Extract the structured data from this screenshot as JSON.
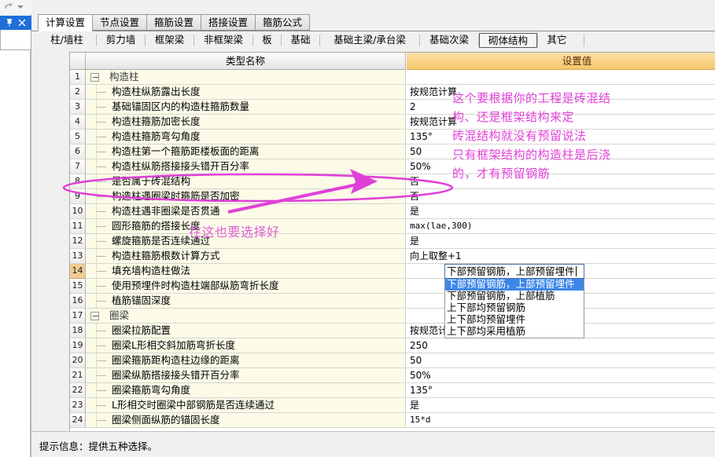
{
  "left_rail": {
    "redo_icon": "redo-icon",
    "redo_caret": "chevron-down-icon",
    "pin_icon": "pin-icon",
    "close_icon": "close-icon"
  },
  "tabs_primary": [
    {
      "label": "计算设置",
      "selected": true
    },
    {
      "label": "节点设置",
      "selected": false
    },
    {
      "label": "箍筋设置",
      "selected": false
    },
    {
      "label": "搭接设置",
      "selected": false
    },
    {
      "label": "箍筋公式",
      "selected": false
    }
  ],
  "tabs_secondary": [
    {
      "label": "柱/墙柱",
      "selected": false
    },
    {
      "label": "剪力墙",
      "selected": false
    },
    {
      "label": "框架梁",
      "selected": false
    },
    {
      "label": "非框架梁",
      "selected": false
    },
    {
      "label": "板",
      "selected": false
    },
    {
      "label": "基础",
      "selected": false
    },
    {
      "label": "基础主梁/承台梁",
      "selected": false
    },
    {
      "label": "基础次梁",
      "selected": false
    },
    {
      "label": "砌体结构",
      "selected": true
    },
    {
      "label": "其它",
      "selected": false
    }
  ],
  "grid": {
    "headers": {
      "number": "",
      "name": "类型名称",
      "value": "设置值"
    },
    "rows": [
      {
        "n": "1",
        "name": "构造柱",
        "value": "",
        "kind": "group",
        "active": false
      },
      {
        "n": "2",
        "name": "构造柱纵筋露出长度",
        "value": "按规范计算",
        "kind": "leaf",
        "active": false
      },
      {
        "n": "3",
        "name": "基础锚固区内的构造柱箍筋数量",
        "value": "2",
        "kind": "leaf",
        "active": false
      },
      {
        "n": "4",
        "name": "构造柱箍筋加密长度",
        "value": "按规范计算",
        "kind": "leaf",
        "active": false
      },
      {
        "n": "5",
        "name": "构造柱箍筋弯勾角度",
        "value": "135°",
        "kind": "leaf",
        "active": false
      },
      {
        "n": "6",
        "name": "构造柱第一个箍筋距楼板面的距离",
        "value": "50",
        "kind": "leaf",
        "active": false
      },
      {
        "n": "7",
        "name": "构造柱纵筋搭接接头错开百分率",
        "value": "50%",
        "kind": "leaf",
        "active": false
      },
      {
        "n": "8",
        "name": "是否属于砖混结构",
        "value": "否",
        "kind": "leaf",
        "active": false
      },
      {
        "n": "9",
        "name": "构造柱遇圈梁时箍筋是否加密",
        "value": "否",
        "kind": "leaf",
        "active": false
      },
      {
        "n": "10",
        "name": "构造柱遇非圈梁是否贯通",
        "value": "是",
        "kind": "leaf",
        "active": false
      },
      {
        "n": "11",
        "name": "圆形箍筋的搭接长度",
        "value": "max(lae,300)",
        "kind": "leaf",
        "active": false,
        "mono": true
      },
      {
        "n": "12",
        "name": "螺旋箍筋是否连续通过",
        "value": "是",
        "kind": "leaf",
        "active": false
      },
      {
        "n": "13",
        "name": "构造柱箍筋根数计算方式",
        "value": "向上取整+1",
        "kind": "leaf",
        "active": false
      },
      {
        "n": "14",
        "name": "填充墙构造柱做法",
        "value": "",
        "kind": "leaf",
        "active": true
      },
      {
        "n": "15",
        "name": "使用预埋件时构造柱端部纵筋弯折长度",
        "value": "",
        "kind": "leaf",
        "active": false
      },
      {
        "n": "16",
        "name": "植筋锚固深度",
        "value": "",
        "kind": "leaf",
        "active": false
      },
      {
        "n": "17",
        "name": "圈梁",
        "value": "",
        "kind": "group",
        "active": false
      },
      {
        "n": "18",
        "name": "圈梁拉筋配置",
        "value": "按规范计算",
        "kind": "leaf",
        "active": false
      },
      {
        "n": "19",
        "name": "圈梁L形相交斜加筋弯折长度",
        "value": "250",
        "kind": "leaf",
        "active": false
      },
      {
        "n": "20",
        "name": "圈梁箍筋距构造柱边缘的距离",
        "value": "50",
        "kind": "leaf",
        "active": false
      },
      {
        "n": "21",
        "name": "圈梁纵筋搭接接头错开百分率",
        "value": "50%",
        "kind": "leaf",
        "active": false
      },
      {
        "n": "22",
        "name": "圈梁箍筋弯勾角度",
        "value": "135°",
        "kind": "leaf",
        "active": false
      },
      {
        "n": "23",
        "name": "L形相交时圈梁中部钢筋是否连续通过",
        "value": "是",
        "kind": "leaf",
        "active": false
      },
      {
        "n": "24",
        "name": "圈梁侧面纵筋的锚固长度",
        "value": "15*d",
        "kind": "leaf",
        "active": false,
        "mono": true
      }
    ]
  },
  "editor": {
    "value": "下部预留钢筋，上部预留埋件",
    "options": [
      {
        "label": "下部预留钢筋，上部预留埋件",
        "selected": true
      },
      {
        "label": "下部预留钢筋，上部植筋",
        "selected": false
      },
      {
        "label": "上下部均预留钢筋",
        "selected": false
      },
      {
        "label": "上下部均预留埋件",
        "selected": false
      },
      {
        "label": "上下部均采用植筋",
        "selected": false
      }
    ]
  },
  "status": {
    "text": "提示信息：提供五种选择。"
  },
  "annotations": {
    "color": "#e040d8",
    "line1": "这个要根据你的工程是砖混结",
    "line2": "构、还是框架结构来定",
    "line3": "砖混结构就没有预留说法",
    "line4": "只有框架结构的构造柱是后浇",
    "line5": "的，才有预留钢筋",
    "line6": "在这也要选择好"
  }
}
